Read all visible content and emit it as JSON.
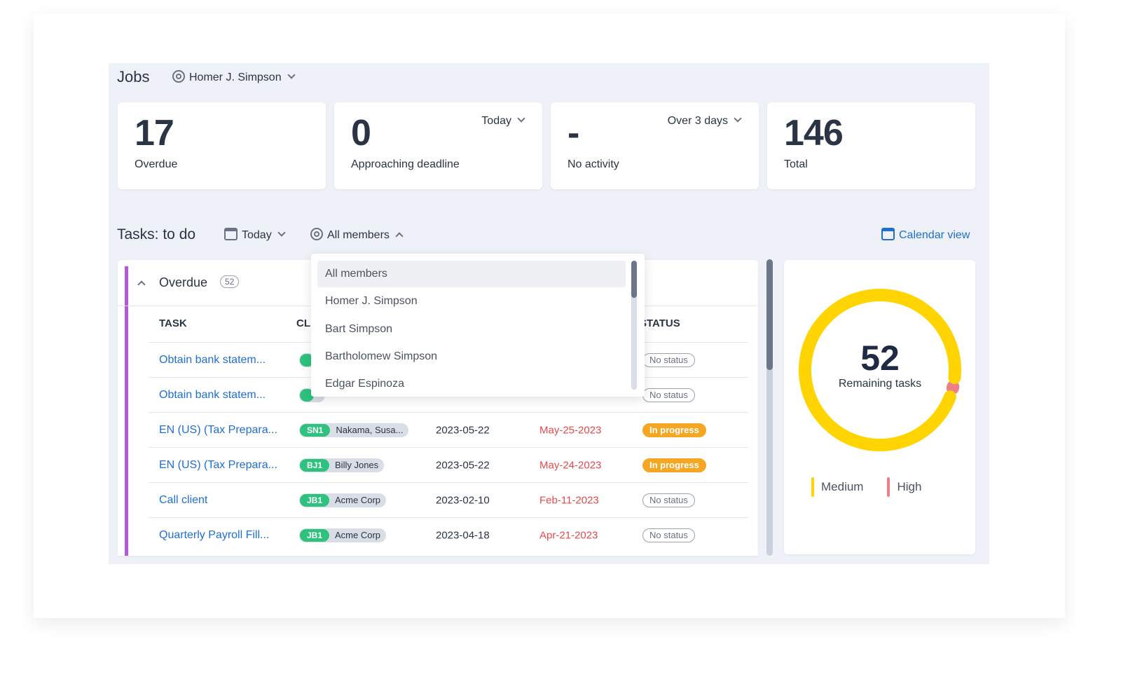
{
  "header": {
    "title": "Jobs",
    "user_filter": "Homer J. Simpson"
  },
  "stats": [
    {
      "value": "17",
      "label": "Overdue"
    },
    {
      "value": "0",
      "label": "Approaching deadline",
      "filter": "Today"
    },
    {
      "value": "-",
      "label": "No activity",
      "filter": "Over 3 days"
    },
    {
      "value": "146",
      "label": "Total"
    }
  ],
  "tasks": {
    "title": "Tasks: to do",
    "date_filter": "Today",
    "member_filter": "All members",
    "calendar_view": "Calendar view",
    "group": {
      "label": "Overdue",
      "count": "52"
    },
    "columns": {
      "task": "TASK",
      "client": "CL",
      "status": "STATUS"
    },
    "rows": [
      {
        "task": "Obtain bank statem...",
        "code": "",
        "client": "",
        "date": "",
        "deadline": "",
        "status": "No status",
        "status_type": "none"
      },
      {
        "task": "Obtain bank statem...",
        "code": "",
        "client": "",
        "date": "",
        "deadline": "",
        "status": "No status",
        "status_type": "none"
      },
      {
        "task": "EN (US) (Tax Prepara...",
        "code": "SN1",
        "client": "Nakama, Susa...",
        "date": "2023-05-22",
        "deadline": "May-25-2023",
        "status": "In progress",
        "status_type": "prog"
      },
      {
        "task": "EN (US) (Tax Prepara...",
        "code": "BJ1",
        "client": "Billy Jones",
        "date": "2023-05-22",
        "deadline": "May-24-2023",
        "status": "In progress",
        "status_type": "prog"
      },
      {
        "task": "Call client",
        "code": "JB1",
        "client": "Acme Corp",
        "date": "2023-02-10",
        "deadline": "Feb-11-2023",
        "status": "No status",
        "status_type": "none"
      },
      {
        "task": "Quarterly Payroll Fill...",
        "code": "JB1",
        "client": "Acme Corp",
        "date": "2023-04-18",
        "deadline": "Apr-21-2023",
        "status": "No status",
        "status_type": "none"
      }
    ]
  },
  "member_dropdown": {
    "options": [
      "All members",
      "Homer J. Simpson",
      "Bart Simpson",
      "Bartholomew Simpson",
      "Edgar Espinoza"
    ],
    "selected": "All members"
  },
  "chart_data": {
    "type": "pie",
    "center_value": "52",
    "center_label": "Remaining tasks",
    "series": [
      {
        "name": "Medium",
        "value": 51,
        "color": "#ffd400"
      },
      {
        "name": "High",
        "value": 1,
        "color": "#ef7f86"
      }
    ]
  },
  "colors": {
    "accent": "#1f6fd1",
    "overdue_bar": "#b659d6",
    "danger": "#e5484d",
    "in_progress": "#f5a623",
    "client_code": "#2ec27e"
  }
}
